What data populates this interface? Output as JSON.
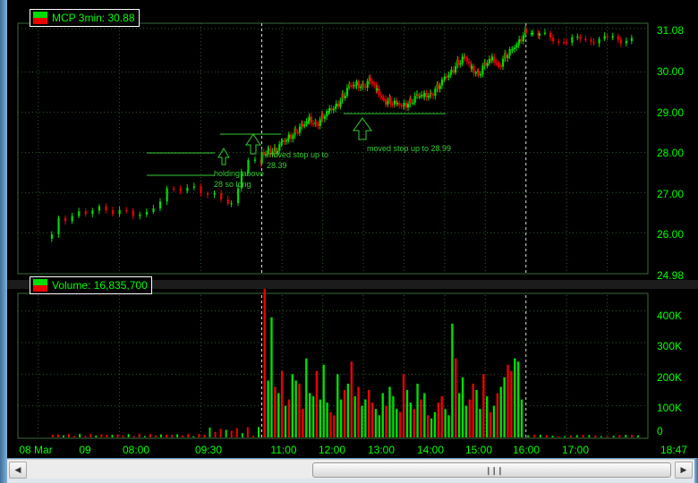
{
  "price_panel": {
    "title": "MCP 3min: 30.88",
    "y_ticks": [
      "31.08",
      "30.00",
      "29.00",
      "28.00",
      "27.00",
      "26.00",
      "24.98"
    ],
    "annotations": {
      "holding": [
        "holding above",
        "28 so long"
      ],
      "stop1": [
        "moved stop up to",
        "28.39"
      ],
      "stop2": [
        "moved stop up to 28.99"
      ]
    }
  },
  "volume_panel": {
    "title": "Volume: 16,835,700",
    "y_ticks": [
      "400K",
      "300K",
      "200K",
      "100K",
      "0"
    ]
  },
  "x_axis": {
    "labels": [
      "08 Mar",
      "09",
      "08:00",
      "09:30",
      "11:00",
      "12:00",
      "13:00",
      "14:00",
      "15:00",
      "16:00",
      "17:00",
      "18:47"
    ]
  },
  "colors": {
    "up": "#00dd00",
    "down": "#ee0000",
    "grid": "#2b5a2b",
    "axis_text": "#00ff00",
    "annotation": "#33cc33",
    "session_line": "#dddddd"
  },
  "scrollbar": {
    "left_icon": "arrow-left-icon",
    "right_icon": "arrow-right-icon",
    "grip_icon": "grip-icon"
  },
  "chart_data": {
    "type": "candlestick",
    "session_markers": [
      "09:30",
      "16:00"
    ],
    "price": {
      "ylim": [
        24.98,
        31.08
      ],
      "series": [
        {
          "time": "04:20",
          "close": 25.85
        },
        {
          "time": "04:30",
          "close": 26.3
        },
        {
          "time": "04:50",
          "close": 26.35
        },
        {
          "time": "05:20",
          "close": 26.55
        },
        {
          "time": "05:40",
          "close": 26.52
        },
        {
          "time": "06:00",
          "close": 26.48
        },
        {
          "time": "06:20",
          "close": 26.45
        },
        {
          "time": "06:40",
          "close": 26.4
        },
        {
          "time": "07:10",
          "close": 27.0
        },
        {
          "time": "07:30",
          "close": 27.08
        },
        {
          "time": "07:50",
          "close": 27.05
        },
        {
          "time": "08:10",
          "close": 26.95
        },
        {
          "time": "08:30",
          "close": 26.8
        },
        {
          "time": "08:45",
          "close": 26.75
        },
        {
          "time": "09:00",
          "close": 27.45
        },
        {
          "time": "09:10",
          "close": 27.85
        },
        {
          "time": "09:20",
          "close": 27.8
        },
        {
          "time": "09:29",
          "close": 27.7
        },
        {
          "time": "09:30",
          "close": 27.9
        },
        {
          "time": "09:40",
          "close": 28.1
        },
        {
          "time": "09:50",
          "close": 28.0
        },
        {
          "time": "10:00",
          "close": 28.2
        },
        {
          "time": "10:10",
          "close": 28.4
        },
        {
          "time": "10:20",
          "close": 28.55
        },
        {
          "time": "10:30",
          "close": 28.6
        },
        {
          "time": "10:40",
          "close": 28.8
        },
        {
          "time": "10:50",
          "close": 28.75
        },
        {
          "time": "11:00",
          "close": 28.85
        },
        {
          "time": "11:10",
          "close": 29.0
        },
        {
          "time": "11:20",
          "close": 29.2
        },
        {
          "time": "11:30",
          "close": 29.4
        },
        {
          "time": "11:40",
          "close": 29.6
        },
        {
          "time": "11:50",
          "close": 29.7
        },
        {
          "time": "12:00",
          "close": 29.7
        },
        {
          "time": "12:10",
          "close": 29.75
        },
        {
          "time": "12:20",
          "close": 29.5
        },
        {
          "time": "12:30",
          "close": 29.35
        },
        {
          "time": "12:40",
          "close": 29.25
        },
        {
          "time": "12:50",
          "close": 29.15
        },
        {
          "time": "13:00",
          "close": 29.2
        },
        {
          "time": "13:10",
          "close": 29.3
        },
        {
          "time": "13:20",
          "close": 29.35
        },
        {
          "time": "13:30",
          "close": 29.4
        },
        {
          "time": "13:40",
          "close": 29.5
        },
        {
          "time": "13:50",
          "close": 29.6
        },
        {
          "time": "14:00",
          "close": 29.8
        },
        {
          "time": "14:10",
          "close": 30.05
        },
        {
          "time": "14:20",
          "close": 30.25
        },
        {
          "time": "14:30",
          "close": 30.3
        },
        {
          "time": "14:40",
          "close": 30.1
        },
        {
          "time": "14:50",
          "close": 30.0
        },
        {
          "time": "15:00",
          "close": 30.15
        },
        {
          "time": "15:10",
          "close": 30.3
        },
        {
          "time": "15:20",
          "close": 30.2
        },
        {
          "time": "15:30",
          "close": 30.4
        },
        {
          "time": "15:40",
          "close": 30.5
        },
        {
          "time": "15:50",
          "close": 30.8
        },
        {
          "time": "16:00",
          "close": 31.05
        },
        {
          "time": "16:10",
          "close": 30.95
        },
        {
          "time": "16:20",
          "close": 30.9
        },
        {
          "time": "16:40",
          "close": 30.8
        },
        {
          "time": "17:00",
          "close": 30.75
        },
        {
          "time": "17:20",
          "close": 30.78
        },
        {
          "time": "17:40",
          "close": 30.8
        },
        {
          "time": "18:00",
          "close": 30.8
        },
        {
          "time": "18:20",
          "close": 30.78
        },
        {
          "time": "18:40",
          "close": 30.85
        }
      ]
    },
    "volume": {
      "ylim": [
        0,
        450000
      ],
      "session_sample": [
        470000,
        180000,
        380000,
        160000,
        140000,
        210000,
        100000,
        120000,
        200000,
        180000,
        170000,
        90000,
        250000,
        140000,
        130000,
        210000,
        120000,
        230000,
        110000,
        80000,
        70000,
        200000,
        120000,
        150000,
        170000,
        240000,
        130000,
        160000,
        100000,
        120000,
        150000,
        110000,
        90000,
        70000,
        140000,
        100000,
        160000,
        130000,
        90000,
        80000,
        200000,
        150000,
        110000,
        90000,
        170000,
        120000,
        140000,
        70000,
        60000,
        80000,
        110000,
        130000,
        90000,
        70000,
        360000,
        250000,
        140000,
        190000,
        100000,
        120000,
        170000,
        150000,
        90000,
        200000,
        130000,
        80000,
        100000,
        140000,
        160000,
        190000,
        230000,
        210000,
        250000,
        240000,
        120000
      ]
    }
  }
}
